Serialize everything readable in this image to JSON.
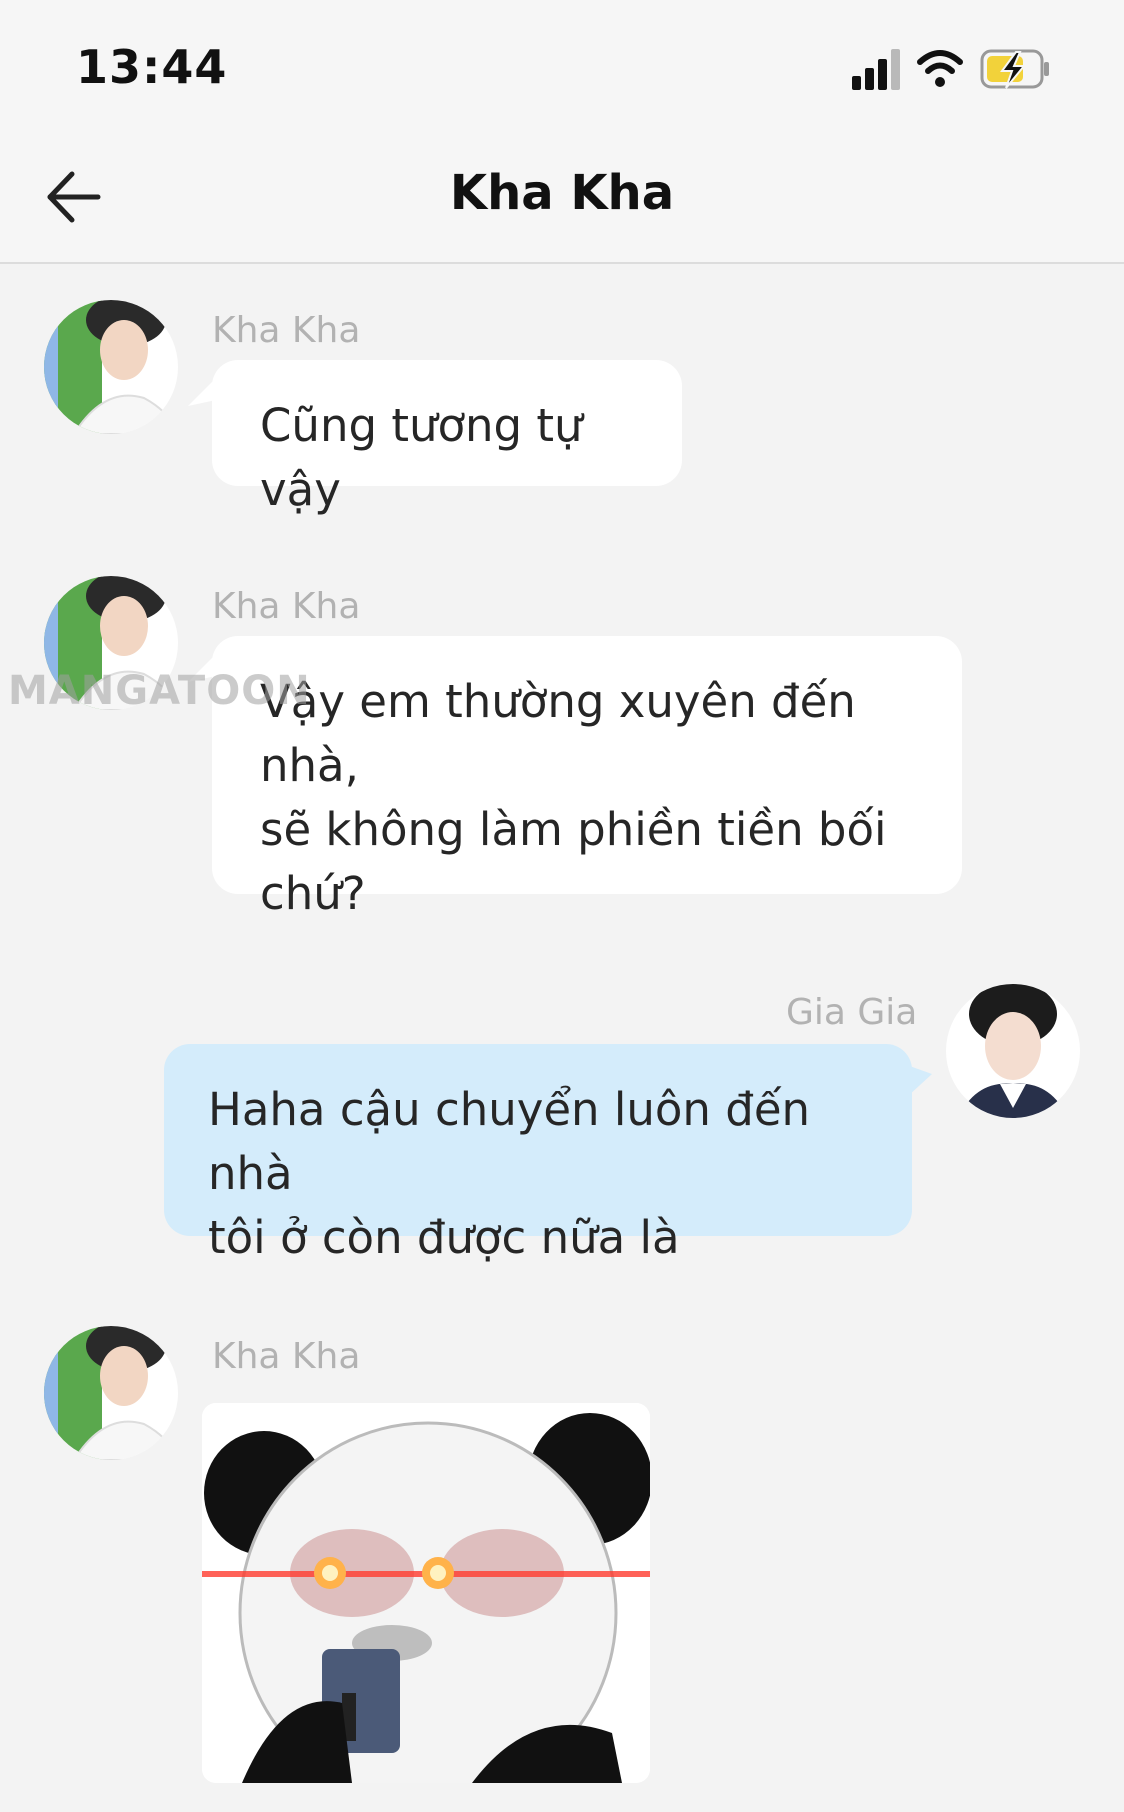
{
  "status_bar": {
    "time": "13:44",
    "icons": [
      "signal-icon",
      "wifi-icon",
      "battery-charging-icon"
    ]
  },
  "header": {
    "title": "Kha Kha",
    "back_icon": "arrow-left-icon"
  },
  "watermark": "MANGATOON",
  "messages": [
    {
      "sender": "Kha Kha",
      "side": "left",
      "type": "text",
      "lines": [
        "Cũng tương tự vậy"
      ]
    },
    {
      "sender": "Kha Kha",
      "side": "left",
      "type": "text",
      "lines": [
        "Vậy em thường xuyên đến nhà,",
        "sẽ không làm phiền tiền bối",
        "chứ?"
      ]
    },
    {
      "sender": "Gia Gia",
      "side": "right",
      "type": "text",
      "lines": [
        "Haha cậu chuyển luôn đến nhà",
        "tôi ở còn được nữa là"
      ]
    },
    {
      "sender": "Kha Kha",
      "side": "left",
      "type": "sticker",
      "sticker": "panda-laser-eyes-sticker"
    }
  ],
  "colors": {
    "incoming_bubble": "#ffffff",
    "outgoing_bubble": "#d4ecfb",
    "sender_name": "#b2b2b2",
    "background": "#f3f3f3"
  }
}
